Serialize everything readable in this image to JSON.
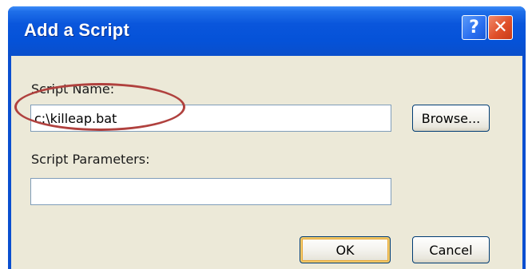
{
  "window": {
    "title": "Add a Script",
    "help_symbol": "?",
    "close_symbol": "✕"
  },
  "form": {
    "script_name_label": "Script Name:",
    "script_name_value": "c:\\killeap.bat",
    "script_parameters_label": "Script Parameters:",
    "script_parameters_value": ""
  },
  "buttons": {
    "browse": "Browse...",
    "ok": "OK",
    "cancel": "Cancel"
  },
  "annotation": {
    "color": "#b0413e",
    "shape": "ellipse"
  },
  "colors": {
    "titlebar": "#0552d8",
    "dialog_background": "#ece9d8",
    "close_button": "#e0502a"
  }
}
